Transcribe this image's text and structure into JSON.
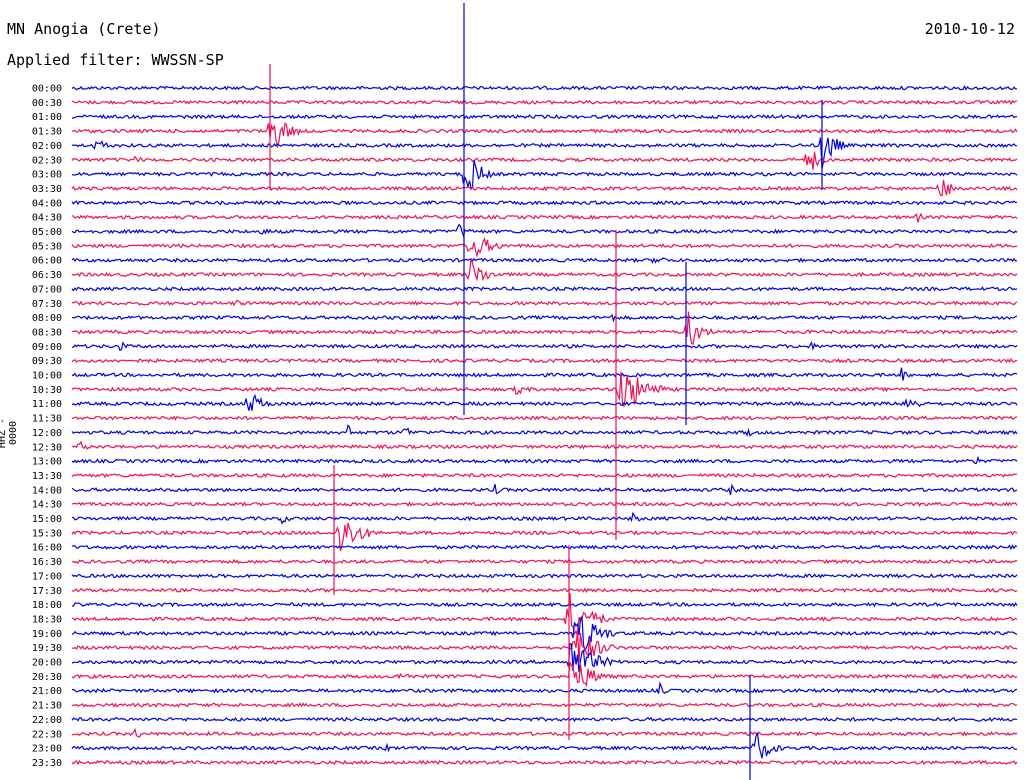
{
  "header": {
    "station": "MN Anogia (Crete)",
    "filter": "Applied filter: WWSSN-SP",
    "date": "2010-10-12"
  },
  "channel_label": "HHZ - 0000",
  "colors": {
    "even_row": "#0000dd",
    "odd_row": "#ee1155"
  },
  "time_labels": [
    "00:00",
    "00:30",
    "01:00",
    "01:30",
    "02:00",
    "02:30",
    "03:00",
    "03:30",
    "04:00",
    "04:30",
    "05:00",
    "05:30",
    "06:00",
    "06:30",
    "07:00",
    "07:30",
    "08:00",
    "08:30",
    "09:00",
    "09:30",
    "10:00",
    "10:30",
    "11:00",
    "11:30",
    "12:00",
    "12:30",
    "13:00",
    "13:30",
    "14:00",
    "14:30",
    "15:00",
    "15:30",
    "16:00",
    "16:30",
    "17:00",
    "17:30",
    "18:00",
    "18:30",
    "19:00",
    "19:30",
    "20:00",
    "20:30",
    "21:00",
    "21:30",
    "22:00",
    "22:30",
    "23:00",
    "23:30"
  ]
}
